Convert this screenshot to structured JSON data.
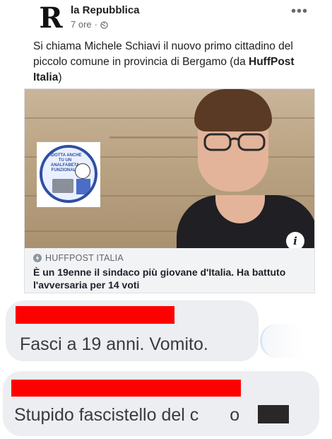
{
  "post": {
    "page_name": "la Repubblica",
    "avatar_letter": "R",
    "time": "7 ore",
    "separator": "·",
    "more_label": "•••",
    "text_main": "Si chiama Michele Schiavi il nuovo primo cittadino del piccolo comune in provincia di Bergamo (da ",
    "text_bold": "HuffPost Italia",
    "text_end": ")"
  },
  "link_card": {
    "source": "HUFFPOST ITALIA",
    "title": "È un 19enne il sindaco più giovane d'Italia. Ha battuto l'avversaria per 14 voti",
    "info_label": "i",
    "sticker_text": "ADOTTA ANCHE TU UN ANALFABETA FUNZIONALE"
  },
  "comments": [
    {
      "text": "Fasci a 19 anni. Vomito."
    },
    {
      "text": "Stupido fascistello del c",
      "suffix": "o"
    }
  ],
  "colors": {
    "redaction": "#ff0000",
    "bubble": "#eceef1",
    "meta_gray": "#65676b"
  },
  "icons": [
    "globe-icon",
    "more-icon",
    "info-icon",
    "source-icon"
  ]
}
